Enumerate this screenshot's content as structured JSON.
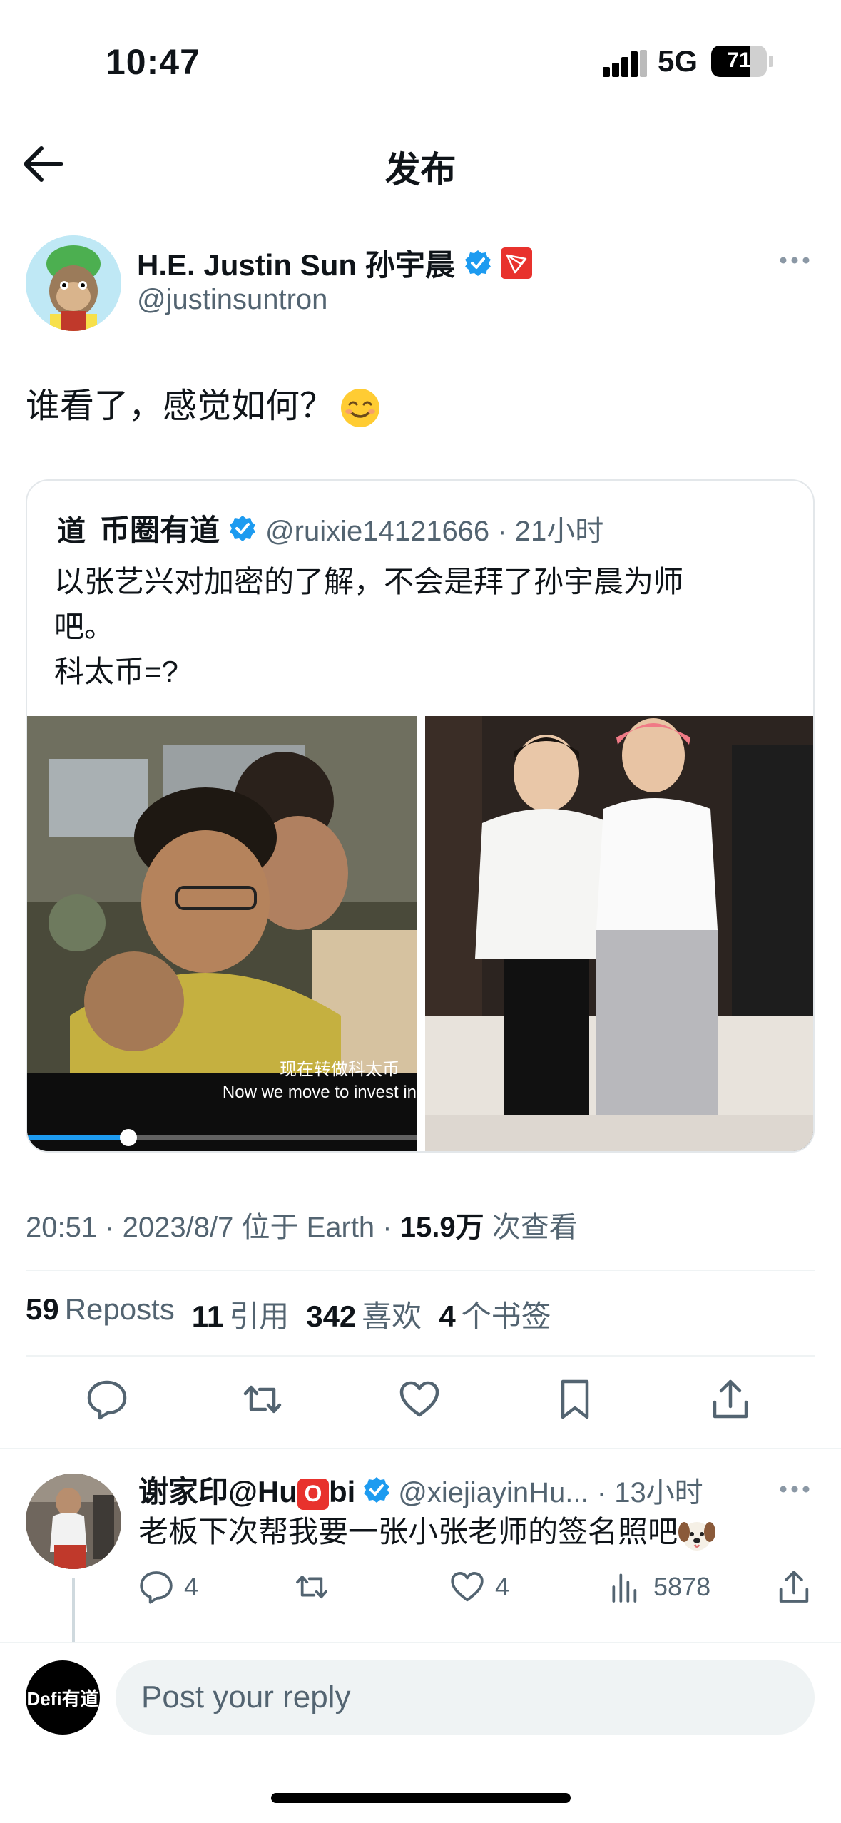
{
  "status_bar": {
    "time": "10:47",
    "network": "5G",
    "battery": "71",
    "battery_level": 0.71
  },
  "header": {
    "title": "发布"
  },
  "tweet": {
    "author_name": "H.E. Justin Sun 孙宇晨",
    "author_handle": "@justinsuntron",
    "text": "谁看了，感觉如何？",
    "quote": {
      "avatar_glyph": "道",
      "name": "币圈有道",
      "meta": "@ruixie14121666 · 21小时",
      "text": "以张艺兴对加密的了解，不会是拜了孙宇晨为师\n吧。\n科太币=?",
      "video_subtitle_cn": "现在转做科太币",
      "video_subtitle_en": "Now we move to invest in",
      "video_progress": 0.26
    },
    "meta": {
      "time_date": "20:51 · 2023/8/7 位于 Earth · ",
      "views_count": "15.9万",
      "views_label": " 次查看"
    },
    "stats": {
      "reposts_count": "59",
      "reposts_label": "Reposts",
      "quotes_count": "11",
      "quotes_label": "引用",
      "likes_count": "342",
      "likes_label": "喜欢",
      "bookmarks_count": "4",
      "bookmarks_label": "个书签"
    }
  },
  "reply": {
    "name_prefix": "谢家印@Hu",
    "name_badge": "O",
    "name_suffix": "bi",
    "meta": "@xiejiayinHu... · 13小时",
    "text": "老板下次帮我要一张小张老师的签名照吧",
    "replies": "4",
    "likes": "4",
    "views": "5878"
  },
  "compose": {
    "avatar_text": "Defi有道",
    "placeholder": "Post your reply"
  },
  "colors": {
    "accent": "#1d9bf0",
    "text": "#0f1419",
    "secondary": "#536471",
    "tron_red": "#e8322d"
  },
  "icons": [
    "back-arrow-icon",
    "verified-icon",
    "tron-icon",
    "more-icon",
    "reply-icon",
    "repost-icon",
    "like-icon",
    "bookmark-icon",
    "share-icon",
    "views-icon"
  ]
}
